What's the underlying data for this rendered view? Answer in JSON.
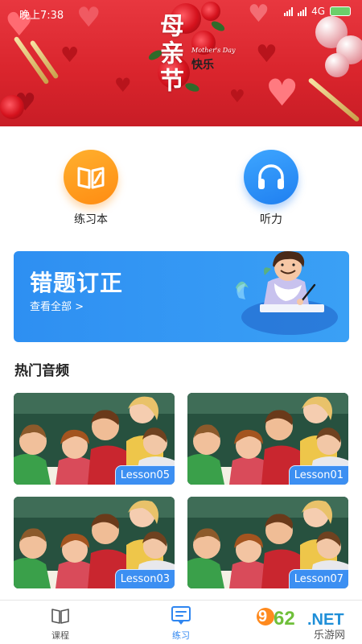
{
  "status_bar": {
    "time": "晚上7:38",
    "network": "4G"
  },
  "banner": {
    "festival_title": "母亲节",
    "festival_sub": "快乐",
    "english_script": "Mother's Day"
  },
  "quick_entries": {
    "workbook": {
      "label": "练习本",
      "icon": "open-book-pencil-icon",
      "color": "#ff9c1e"
    },
    "listening": {
      "label": "听力",
      "icon": "headphones-icon",
      "color": "#2f8ef2"
    }
  },
  "mistake_banner": {
    "title": "错题订正",
    "link": "查看全部 >",
    "color": "#3498f3"
  },
  "hot_audio": {
    "title": "热门音频",
    "items": [
      {
        "lesson": "Lesson05"
      },
      {
        "lesson": "Lesson01"
      },
      {
        "lesson": "Lesson03"
      },
      {
        "lesson": "Lesson07"
      }
    ]
  },
  "tabbar": {
    "items": [
      {
        "label": "课程",
        "icon": "book-icon",
        "active": false
      },
      {
        "label": "练习",
        "icon": "practice-list-icon",
        "active": true
      }
    ],
    "active_color": "#2f86f0"
  },
  "watermark": {
    "number": "962",
    "tld": ".NET",
    "site": "乐游网"
  }
}
